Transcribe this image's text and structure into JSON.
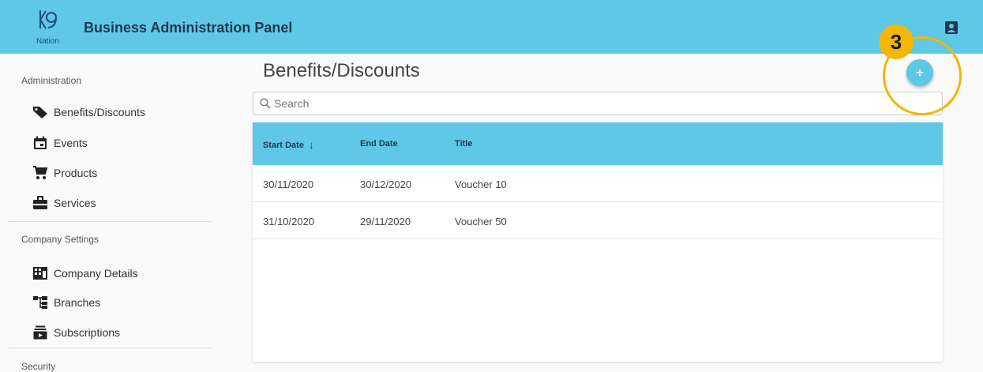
{
  "header": {
    "logo_text": "Nation",
    "title": "Business Administration Panel",
    "account_icon": "account-box-icon",
    "brand_color": "#5ec8e6"
  },
  "sidebar": {
    "sections": [
      {
        "title": "Administration"
      },
      {
        "title": "Company Settings"
      },
      {
        "title": "Security"
      }
    ],
    "items": [
      {
        "label": "Benefits/Discounts",
        "icon": "tag-icon"
      },
      {
        "label": "Events",
        "icon": "calendar-icon"
      },
      {
        "label": "Products",
        "icon": "cart-icon"
      },
      {
        "label": "Services",
        "icon": "toolbox-icon"
      },
      {
        "label": "Company Details",
        "icon": "building-icon"
      },
      {
        "label": "Branches",
        "icon": "hierarchy-icon"
      },
      {
        "label": "Subscriptions",
        "icon": "subscriptions-icon"
      }
    ]
  },
  "main": {
    "page_title": "Benefits/Discounts",
    "search_placeholder": "Search",
    "columns": [
      "Start Date",
      "End Date",
      "Title"
    ],
    "sort_indicator": "↓",
    "rows": [
      {
        "start": "30/11/2020",
        "end": "30/12/2020",
        "title": "Voucher 10"
      },
      {
        "start": "31/10/2020",
        "end": "29/11/2020",
        "title": "Voucher 50"
      }
    ],
    "add_button": "+"
  },
  "annotation": {
    "step": "3",
    "color": "#f2b705"
  }
}
